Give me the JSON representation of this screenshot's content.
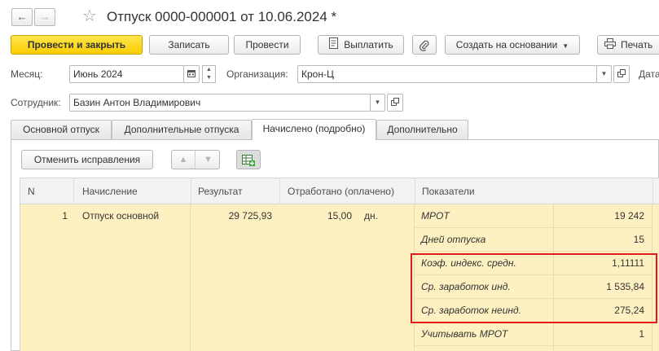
{
  "window": {
    "title": "Отпуск 0000-000001 от 10.06.2024 *"
  },
  "toolbar": {
    "post_close": "Провести и закрыть",
    "save": "Записать",
    "post": "Провести",
    "pay": "Выплатить",
    "create_based": "Создать на основании",
    "print": "Печать"
  },
  "form": {
    "month_label": "Месяц:",
    "month_value": "Июнь 2024",
    "org_label": "Организация:",
    "org_value": "Крон-Ц",
    "date_label": "Дата",
    "employee_label": "Сотрудник:",
    "employee_value": "Базин Антон Владимирович"
  },
  "tabs": [
    {
      "label": "Основной отпуск"
    },
    {
      "label": "Дополнительные отпуска"
    },
    {
      "label": "Начислено (подробно)"
    },
    {
      "label": "Дополнительно"
    }
  ],
  "panel": {
    "cancel_fix": "Отменить исправления"
  },
  "table": {
    "columns": [
      "N",
      "Начисление",
      "Результат",
      "Отработано (оплачено)",
      "Показатели"
    ],
    "row": {
      "n": "1",
      "accrual": "Отпуск основной",
      "result": "29 725,93",
      "worked": "15,00",
      "unit": "дн."
    },
    "indicators": [
      {
        "name": "МРОТ",
        "value": "19 242"
      },
      {
        "name": "Дней отпуска",
        "value": "15"
      },
      {
        "name": "Коэф. индекс. средн.",
        "value": "1,11111"
      },
      {
        "name": "Ср. заработок инд.",
        "value": "1 535,84"
      },
      {
        "name": "Ср. заработок неинд.",
        "value": "275,24"
      },
      {
        "name": "Учитывать МРОТ",
        "value": "1"
      }
    ]
  },
  "colors": {
    "primary_button": "#f8cd00",
    "row_highlight": "#fdf1c2",
    "annotation": "#e11b1b"
  }
}
